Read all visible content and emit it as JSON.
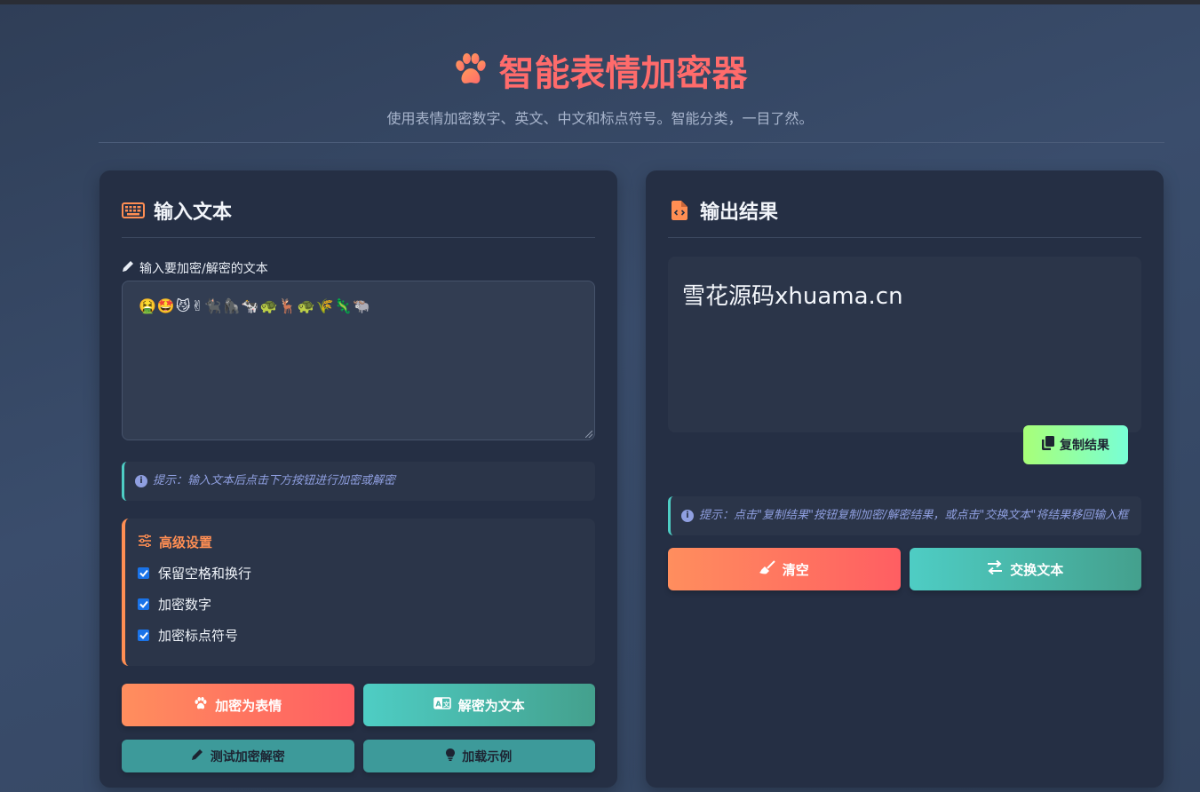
{
  "header": {
    "title": "智能表情加密器",
    "subtitle": "使用表情加密数字、英文、中文和标点符号。智能分类，一目了然。"
  },
  "input_panel": {
    "title": "输入文本",
    "field_label": "输入要加密/解密的文本",
    "textarea_value": "🤮🤩😼✌🐈‍⬛🦍🐄🐢🦌🐢🌾🦎🐃",
    "hint": "提示：输入文本后点击下方按钮进行加密或解密",
    "settings": {
      "title": "高级设置",
      "options": [
        {
          "label": "保留空格和换行",
          "checked": true
        },
        {
          "label": "加密数字",
          "checked": true
        },
        {
          "label": "加密标点符号",
          "checked": true
        }
      ]
    },
    "buttons": {
      "encrypt": "加密为表情",
      "decrypt": "解密为文本",
      "test": "测试加密解密",
      "example": "加载示例"
    }
  },
  "output_panel": {
    "title": "输出结果",
    "result": "雪花源码xhuama.cn",
    "copy_button": "复制结果",
    "hint": "提示：点击\"复制结果\"按钮复制加密/解密结果，或点击\"交换文本\"将结果移回输入框",
    "buttons": {
      "clear": "清空",
      "swap": "交换文本"
    }
  },
  "colors": {
    "accent_red": "#ff6b6b",
    "accent_orange": "#ff8e53",
    "accent_teal": "#4ecdc4",
    "panel_bg": "#252f44"
  },
  "icons": {
    "title": "paw-icon",
    "input": "keyboard-icon",
    "output": "file-code-icon",
    "label": "pencil-icon",
    "settings": "sliders-icon",
    "hint": "info-icon",
    "copy": "copy-icon",
    "clear": "broom-icon",
    "swap": "swap-icon",
    "decrypt": "language-icon",
    "example": "lightbulb-icon"
  }
}
